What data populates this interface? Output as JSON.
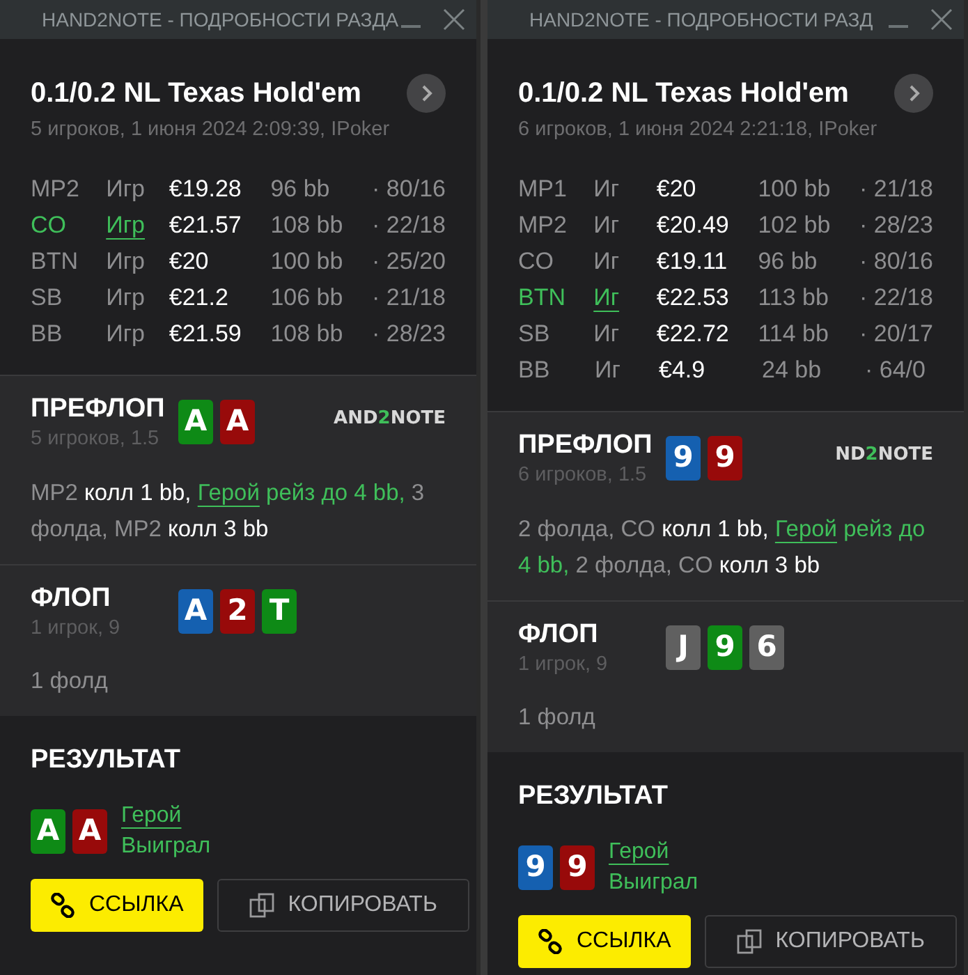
{
  "windows": [
    {
      "title": "HAND2NOTE - ПОДРОБНОСТИ РАЗДА",
      "header": {
        "title": "0.1/0.2 NL Texas Hold'em",
        "subtitle": "5 игроков, 1 июня 2024 2:09:39, IPoker"
      },
      "players": [
        {
          "position": "MP2",
          "name": "Игр",
          "stack": "€19.28",
          "bb": "96 bb",
          "stats": "· 80/16",
          "hero": false
        },
        {
          "position": "CO",
          "name": "Игр",
          "stack": "€21.57",
          "bb": "108 bb",
          "stats": "· 22/18",
          "hero": true
        },
        {
          "position": "BTN",
          "name": "Игр",
          "stack": "€20",
          "bb": "100 bb",
          "stats": "· 25/20",
          "hero": false
        },
        {
          "position": "SB",
          "name": "Игр",
          "stack": "€21.2",
          "bb": "106 bb",
          "stats": "· 21/18",
          "hero": false
        },
        {
          "position": "BB",
          "name": "Игр",
          "stack": "€21.59",
          "bb": "108 bb",
          "stats": "· 28/23",
          "hero": false
        }
      ],
      "streets": [
        {
          "title": "ПРЕФЛОП",
          "subtitle": "5 игроков, 1.5",
          "cards": [
            {
              "rank": "A",
              "color": "#0e8a16"
            },
            {
              "rank": "A",
              "color": "#980a0a"
            }
          ],
          "logo": {
            "prefix": "AND",
            "accent": "2",
            "suffix": "NOTE"
          },
          "actions": [
            {
              "text": "MP2 ",
              "kind": "muted"
            },
            {
              "text": "колл 1 bb, ",
              "kind": "bold"
            },
            {
              "text": "Герой",
              "kind": "hero-link"
            },
            {
              "text": " рейз до 4 bb,",
              "kind": "hero"
            },
            {
              "text": " 3 фолда, MP2 ",
              "kind": "muted"
            },
            {
              "text": "колл 3 bb",
              "kind": "bold"
            }
          ]
        },
        {
          "title": "ФЛОП",
          "subtitle": "1 игрок, 9",
          "cards": [
            {
              "rank": "A",
              "color": "#1560b0"
            },
            {
              "rank": "2",
              "color": "#980a0a"
            },
            {
              "rank": "T",
              "color": "#0e8a16"
            }
          ],
          "actions": [
            {
              "text": "1 фолд",
              "kind": "muted"
            }
          ]
        }
      ],
      "result": {
        "title": "РЕЗУЛЬТАТ",
        "cards": [
          {
            "rank": "A",
            "color": "#0e8a16"
          },
          {
            "rank": "A",
            "color": "#980a0a"
          }
        ],
        "hero": "Герой",
        "outcome": "Выиграл"
      },
      "buttons": [
        {
          "label": "ССЫЛКА",
          "kind": "primary"
        },
        {
          "label": "КОПИРОВАТЬ",
          "kind": "secondary"
        }
      ]
    },
    {
      "title": "HAND2NOTE - ПОДРОБНОСТИ РАЗД",
      "header": {
        "title": "0.1/0.2 NL Texas Hold'em",
        "subtitle": "6 игроков, 1 июня 2024 2:21:18, IPoker"
      },
      "players": [
        {
          "position": "MP1",
          "name": "Иг",
          "stack": "€20",
          "bb": "100 bb",
          "stats": "· 21/18",
          "hero": false
        },
        {
          "position": "MP2",
          "name": "Иг",
          "stack": "€20.49",
          "bb": "102 bb",
          "stats": "· 28/23",
          "hero": false
        },
        {
          "position": "CO",
          "name": "Иг",
          "stack": "€19.11",
          "bb": "96 bb",
          "stats": "· 80/16",
          "hero": false
        },
        {
          "position": "BTN",
          "name": "Иг",
          "stack": "€22.53",
          "bb": "113 bb",
          "stats": "· 22/18",
          "hero": true
        },
        {
          "position": "SB",
          "name": "Иг",
          "stack": "€22.72",
          "bb": "114 bb",
          "stats": "· 20/17",
          "hero": false
        },
        {
          "position": "BB",
          "name": "Иг",
          "stack": "€4.9",
          "bb": "24 bb",
          "stats": "· 64/0",
          "hero": false
        }
      ],
      "streets": [
        {
          "title": "ПРЕФЛОП",
          "subtitle": "6 игроков, 1.5",
          "cards": [
            {
              "rank": "9",
              "color": "#1560b0"
            },
            {
              "rank": "9",
              "color": "#980a0a"
            }
          ],
          "logo": {
            "prefix": "ND",
            "accent": "2",
            "suffix": "NOTE"
          },
          "actions": [
            {
              "text": "2 фолда, CO ",
              "kind": "muted"
            },
            {
              "text": "колл 1 bb, ",
              "kind": "bold"
            },
            {
              "text": "Герой",
              "kind": "hero-link"
            },
            {
              "text": " рейз до 4 bb,",
              "kind": "hero"
            },
            {
              "text": " 2 фолда, CO ",
              "kind": "muted"
            },
            {
              "text": "колл 3 bb",
              "kind": "bold"
            }
          ]
        },
        {
          "title": "ФЛОП",
          "subtitle": "1 игрок, 9",
          "cards": [
            {
              "rank": "J",
              "color": "#606060"
            },
            {
              "rank": "9",
              "color": "#0e8a16"
            },
            {
              "rank": "6",
              "color": "#606060"
            }
          ],
          "actions": [
            {
              "text": "1 фолд",
              "kind": "muted"
            }
          ]
        }
      ],
      "result": {
        "title": "РЕЗУЛЬТАТ",
        "cards": [
          {
            "rank": "9",
            "color": "#1560b0"
          },
          {
            "rank": "9",
            "color": "#980a0a"
          }
        ],
        "hero": "Герой",
        "outcome": "Выиграл"
      },
      "buttons": [
        {
          "label": "ССЫЛКА",
          "kind": "primary"
        },
        {
          "label": "КОПИРОВАТЬ",
          "kind": "secondary"
        }
      ]
    }
  ]
}
